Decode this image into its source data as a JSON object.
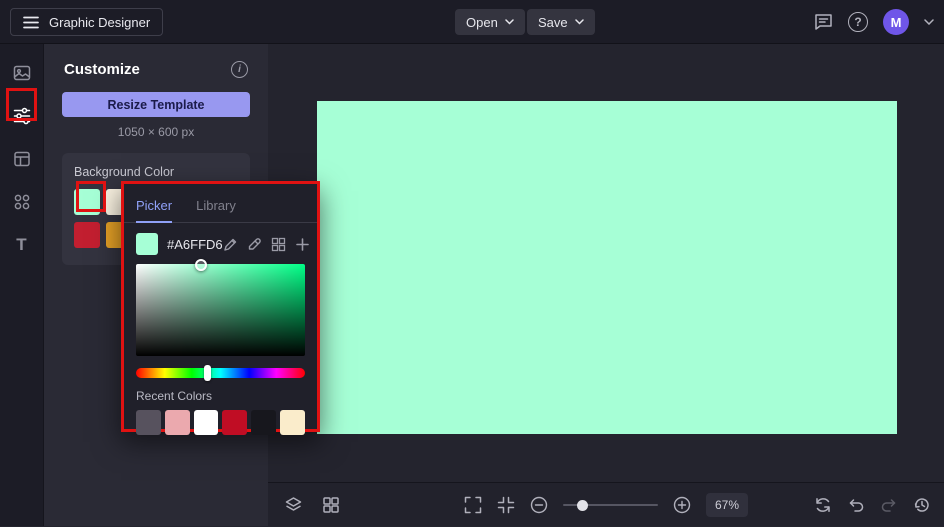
{
  "topbar": {
    "title": "Graphic Designer",
    "open_label": "Open",
    "save_label": "Save",
    "avatar_initial": "M",
    "help_glyph": "?"
  },
  "rail": {
    "items": [
      "media-icon",
      "customize-icon",
      "templates-icon",
      "graphics-icon",
      "text-icon"
    ],
    "text_tool_glyph": "T"
  },
  "panel": {
    "title": "Customize",
    "info_glyph": "i",
    "resize_button_label": "Resize Template",
    "template_dimensions": "1050 × 600 px",
    "background_color": {
      "label": "Background Color",
      "swatches": [
        "#A6FFD6",
        "#FBF3E2",
        "#C21F30",
        "#E5A126"
      ]
    }
  },
  "color_picker": {
    "tabs": {
      "picker": "Picker",
      "library": "Library"
    },
    "hex_value": "#A6FFD6",
    "current_color": "#A6FFD6",
    "recent_colors_label": "Recent Colors",
    "recent_colors": [
      "#57525E",
      "#EBA9AE",
      "#FFFFFF",
      "#C00D24",
      "#17171D",
      "#FAECCB"
    ]
  },
  "canvas": {
    "artboard_fill": "#A6FFD6"
  },
  "toolbar": {
    "zoom_value": "67%"
  },
  "annotations": {
    "highlight_color": "#E01212"
  }
}
